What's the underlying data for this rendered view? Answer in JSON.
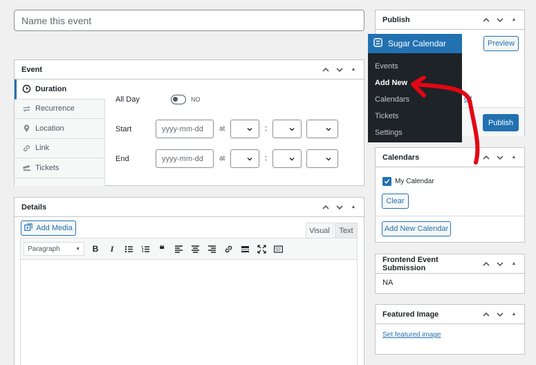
{
  "title_input": {
    "placeholder": "Name this event"
  },
  "event_box": {
    "title": "Event",
    "tabs": [
      "Duration",
      "Recurrence",
      "Location",
      "Link",
      "Tickets"
    ],
    "all_day": {
      "label": "All Day",
      "toggle_text": "NO"
    },
    "start": {
      "label": "Start",
      "date_placeholder": "yyyy-mm-dd",
      "at": "at",
      "colon": ":"
    },
    "end": {
      "label": "End",
      "date_placeholder": "yyyy-mm-dd",
      "at": "at",
      "colon": ":"
    }
  },
  "details_box": {
    "title": "Details",
    "add_media": "Add Media",
    "tab_visual": "Visual",
    "tab_text": "Text",
    "format_select": "Paragraph"
  },
  "publish_box": {
    "title": "Publish",
    "preview": "Preview",
    "edit_link_fragment": "dit",
    "publish": "Publish"
  },
  "sugar_menu": {
    "title": "Sugar Calendar",
    "items": [
      "Events",
      "Add New",
      "Calendars",
      "Tickets",
      "Settings"
    ],
    "current": "Add New"
  },
  "calendars_box": {
    "title": "Calendars",
    "item": "My Calendar",
    "clear": "Clear",
    "add_new": "Add New Calendar"
  },
  "frontend_box": {
    "title": "Frontend Event Submission",
    "value": "NA"
  },
  "featured_box": {
    "title": "Featured Image",
    "link": "Set featured image"
  },
  "colors": {
    "accent": "#2271b1",
    "menu_bg": "#1d2327",
    "annotation": "#e30613"
  }
}
